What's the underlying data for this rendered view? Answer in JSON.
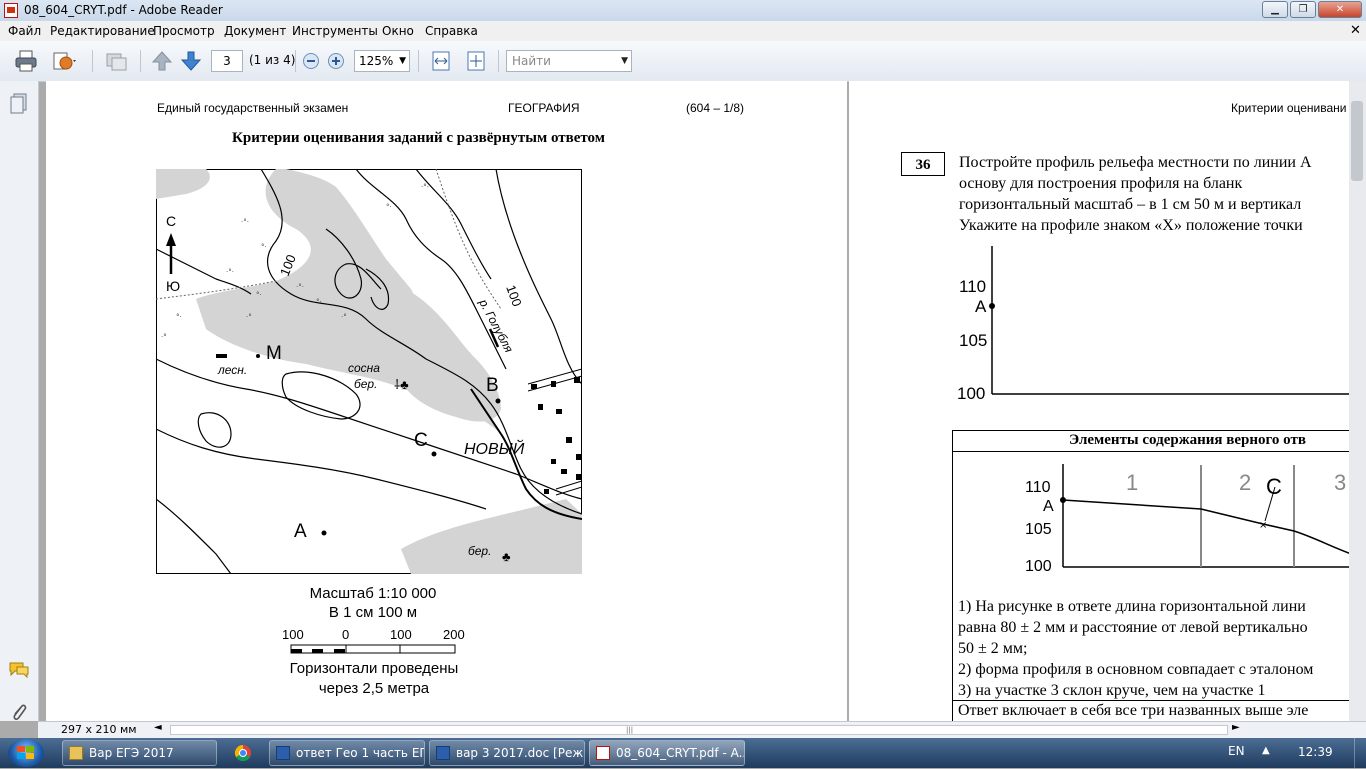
{
  "window": {
    "title": "08_604_CRYT.pdf - Adobe Reader"
  },
  "menu": [
    "Файл",
    "Редактирование",
    "Просмотр",
    "Документ",
    "Инструменты",
    "Окно",
    "Справка"
  ],
  "toolbar": {
    "page_number": "3",
    "page_count": "(1 из 4)",
    "zoom": "125%",
    "find_placeholder": "Найти"
  },
  "left_page": {
    "header_left": "Единый государственный экзамен",
    "header_center": "ГЕОГРАФИЯ",
    "header_right": "(604 – 1/8)",
    "heading": "Критерии оценивания заданий с развёрнутым ответом",
    "map": {
      "north": "С",
      "south": "Ю",
      "contour1": "100",
      "contour2": "100",
      "river": "р. Голубля",
      "point_m": "М",
      "point_b": "В",
      "point_c": "С",
      "point_a": "А",
      "village": "НОВЫЙ",
      "les": "лесн.",
      "sosna": "сосна",
      "ber1": "бер.",
      "ber2": "бер."
    },
    "scale": {
      "title": "Масштаб 1:10 000",
      "subtitle": "В 1 см 100 м",
      "ticks": [
        "100",
        "0",
        "100",
        "200"
      ],
      "contour_line1": "Горизонтали проведены",
      "contour_line2": "через 2,5 метра"
    }
  },
  "right_page": {
    "header": "Критерии оценивани",
    "task_number": "36",
    "task_lines": [
      "Постройте профиль рельефа местности по линии А",
      "основу для построения профиля на бланк",
      "горизонтальный масштаб – в 1 см 50 м и вертикал",
      "Укажите на профиле знаком «Х» положение точки"
    ],
    "chart1": {
      "y_ticks": [
        "110",
        "105",
        "100"
      ],
      "point_a": "А"
    },
    "table_header": "Элементы содержания верного отв",
    "chart2": {
      "y_ticks": [
        "110",
        "105",
        "100"
      ],
      "point_a": "А",
      "point_c": "С",
      "sections": [
        "1",
        "2",
        "3"
      ]
    },
    "criteria": [
      "1) На рисунке в ответе длина горизонтальной лини",
      "равна 80 ± 2 мм и расстояние от левой вертикально",
      "50 ± 2 мм;",
      "2) форма профиля в основном совпадает с эталоном",
      "3) на участке 3 склон круче, чем на участке 1"
    ],
    "footer_line": "Ответ включает в себя все три названных выше эле"
  },
  "statusbar": {
    "page_size": "297 x 210 мм"
  },
  "taskbar": {
    "items": [
      "Вар ЕГЭ 2017",
      "ответ Гео 1 часть ЕГ...",
      "вар 3 2017.doc [Реж...",
      "08_604_CRYT.pdf - A..."
    ],
    "lang": "EN",
    "time": "12:39"
  },
  "colors": {
    "accent": "#3a6ea5",
    "forest": "#d9d9d9",
    "taskbar": "#2a4a72"
  }
}
